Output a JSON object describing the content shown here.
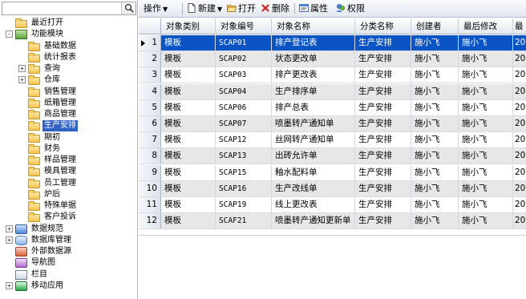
{
  "search": {
    "value": "",
    "icon": "search-icon"
  },
  "tree": [
    {
      "label": "最近打开",
      "icon": "folder",
      "expander": ""
    },
    {
      "label": "功能模块",
      "icon": "module",
      "expander": "-"
    },
    {
      "label": "基础数据",
      "icon": "folder",
      "expander": ""
    },
    {
      "label": "统计报表",
      "icon": "folder",
      "expander": ""
    },
    {
      "label": "查询",
      "icon": "folder",
      "expander": "+"
    },
    {
      "label": "仓库",
      "icon": "folder",
      "expander": "+"
    },
    {
      "label": "销售管理",
      "icon": "folder",
      "expander": ""
    },
    {
      "label": "纸箱管理",
      "icon": "folder",
      "expander": ""
    },
    {
      "label": "商品管理",
      "icon": "folder",
      "expander": ""
    },
    {
      "label": "生产安排",
      "icon": "folder",
      "expander": "",
      "selected": true
    },
    {
      "label": "期初",
      "icon": "folder",
      "expander": ""
    },
    {
      "label": "财务",
      "icon": "folder",
      "expander": ""
    },
    {
      "label": "样品管理",
      "icon": "folder",
      "expander": ""
    },
    {
      "label": "模具管理",
      "icon": "folder",
      "expander": ""
    },
    {
      "label": "员工管理",
      "icon": "folder",
      "expander": ""
    },
    {
      "label": "炉后",
      "icon": "folder",
      "expander": ""
    },
    {
      "label": "特殊单据",
      "icon": "folder",
      "expander": ""
    },
    {
      "label": "客户投诉",
      "icon": "folder",
      "expander": ""
    },
    {
      "label": "数据规范",
      "icon": "rules",
      "expander": "+"
    },
    {
      "label": "数据库管理",
      "icon": "database",
      "expander": "+"
    },
    {
      "label": "外部数据源",
      "icon": "external",
      "expander": ""
    },
    {
      "label": "导航图",
      "icon": "navigation",
      "expander": ""
    },
    {
      "label": "栏目",
      "icon": "column",
      "expander": ""
    },
    {
      "label": "移动应用",
      "icon": "mobile-app",
      "expander": "+"
    }
  ],
  "toolbar": {
    "operate": "操作",
    "new": "新建",
    "open": "打开",
    "delete": "删除",
    "properties": "属性",
    "permissions": "权限"
  },
  "grid": {
    "columns": [
      "对象类别",
      "对象编号",
      "对象名称",
      "分类名称",
      "创建者",
      "最后修改",
      "最"
    ],
    "rows": [
      {
        "n": "1",
        "type": "模板",
        "code": "SCAP01",
        "name": "排产登记表",
        "category": "生产安排",
        "creator": "施小飞",
        "modifier": "施小飞",
        "extra": "20",
        "selected": true
      },
      {
        "n": "2",
        "type": "模板",
        "code": "SCAP02",
        "name": "状态更改单",
        "category": "生产安排",
        "creator": "施小飞",
        "modifier": "施小飞",
        "extra": "20"
      },
      {
        "n": "3",
        "type": "模板",
        "code": "SCAP03",
        "name": "排产更改表",
        "category": "生产安排",
        "creator": "施小飞",
        "modifier": "施小飞",
        "extra": "20"
      },
      {
        "n": "4",
        "type": "模板",
        "code": "SCAP04",
        "name": "生产排序单",
        "category": "生产安排",
        "creator": "施小飞",
        "modifier": "施小飞",
        "extra": "20"
      },
      {
        "n": "5",
        "type": "模板",
        "code": "SCAP06",
        "name": "排产总表",
        "category": "生产安排",
        "creator": "施小飞",
        "modifier": "施小飞",
        "extra": "20"
      },
      {
        "n": "6",
        "type": "模板",
        "code": "SCAP07",
        "name": "喷墨转产通知单",
        "category": "生产安排",
        "creator": "施小飞",
        "modifier": "施小飞",
        "extra": "20"
      },
      {
        "n": "7",
        "type": "模板",
        "code": "SCAP12",
        "name": "丝网转产通知单",
        "category": "生产安排",
        "creator": "施小飞",
        "modifier": "施小飞",
        "extra": "20"
      },
      {
        "n": "8",
        "type": "模板",
        "code": "SCAP13",
        "name": "出砖允许单",
        "category": "生产安排",
        "creator": "施小飞",
        "modifier": "施小飞",
        "extra": "20"
      },
      {
        "n": "9",
        "type": "模板",
        "code": "SCAP15",
        "name": "釉水配料单",
        "category": "生产安排",
        "creator": "施小飞",
        "modifier": "施小飞",
        "extra": "20"
      },
      {
        "n": "10",
        "type": "模板",
        "code": "SCAP16",
        "name": "生产改线单",
        "category": "生产安排",
        "creator": "施小飞",
        "modifier": "施小飞",
        "extra": "20"
      },
      {
        "n": "11",
        "type": "模板",
        "code": "SCAP19",
        "name": "线上更改表",
        "category": "生产安排",
        "creator": "施小飞",
        "modifier": "施小飞",
        "extra": "20"
      },
      {
        "n": "12",
        "type": "模板",
        "code": "SCAF21",
        "name": "喷墨转产通知更新单",
        "category": "生产安排",
        "creator": "施小飞",
        "modifier": "施小飞",
        "extra": "20"
      }
    ]
  },
  "colors": {
    "selection": "#0a54c5",
    "tree_selection": "#3162c5",
    "alt_row": "#e7e7e7"
  }
}
